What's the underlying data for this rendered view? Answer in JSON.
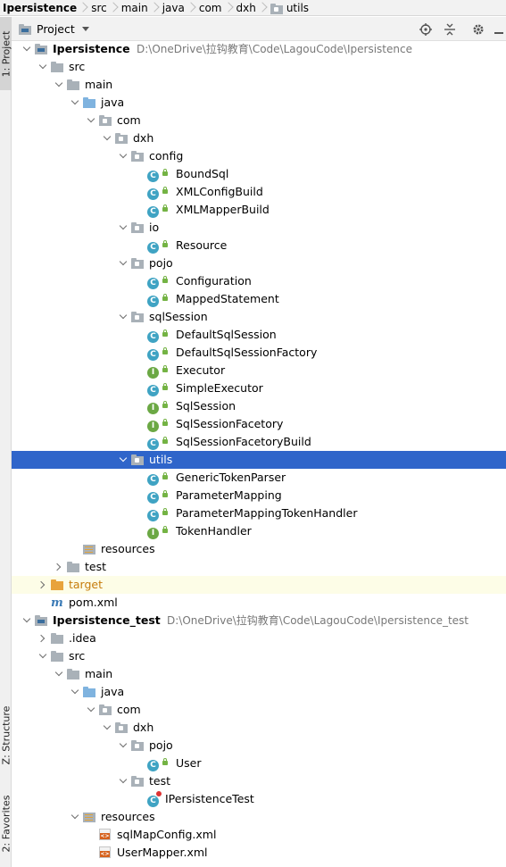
{
  "breadcrumb": [
    {
      "label": "Ipersistence",
      "icon": "module-icon"
    },
    {
      "label": "src",
      "icon": ""
    },
    {
      "label": "main",
      "icon": ""
    },
    {
      "label": "java",
      "icon": ""
    },
    {
      "label": "com",
      "icon": ""
    },
    {
      "label": "dxh",
      "icon": ""
    },
    {
      "label": "utils",
      "icon": "package-folder-icon"
    }
  ],
  "side_tabs": {
    "project": "1: Project",
    "structure": "Z: Structure",
    "favorites": "2: Favorites"
  },
  "panel": {
    "view_label": "Project",
    "buttons": [
      "locate-icon",
      "collapse-all-icon",
      "settings-icon",
      "hide-icon"
    ]
  },
  "colors": {
    "selection": "#2f65ca",
    "class_icon": "#3fa3c3",
    "interface_icon": "#6ba844",
    "excluded_folder": "#e8a33c"
  },
  "tree": [
    {
      "label": "Ipersistence",
      "path": "D:\\OneDrive\\拉钩教育\\Code\\LagouCode\\Ipersistence",
      "depth": 0,
      "expand": "open",
      "icon": "module",
      "bold": true
    },
    {
      "label": "src",
      "depth": 1,
      "expand": "open",
      "icon": "folder-grey"
    },
    {
      "label": "main",
      "depth": 2,
      "expand": "open",
      "icon": "folder-grey"
    },
    {
      "label": "java",
      "depth": 3,
      "expand": "open",
      "icon": "folder-blue"
    },
    {
      "label": "com",
      "depth": 4,
      "expand": "open",
      "icon": "package"
    },
    {
      "label": "dxh",
      "depth": 5,
      "expand": "open",
      "icon": "package"
    },
    {
      "label": "config",
      "depth": 6,
      "expand": "open",
      "icon": "package"
    },
    {
      "label": "BoundSql",
      "depth": 7,
      "icon": "class"
    },
    {
      "label": "XMLConfigBuild",
      "depth": 7,
      "icon": "class"
    },
    {
      "label": "XMLMapperBuild",
      "depth": 7,
      "icon": "class"
    },
    {
      "label": "io",
      "depth": 6,
      "expand": "open",
      "icon": "package"
    },
    {
      "label": "Resource",
      "depth": 7,
      "icon": "class"
    },
    {
      "label": "pojo",
      "depth": 6,
      "expand": "open",
      "icon": "package"
    },
    {
      "label": "Configuration",
      "depth": 7,
      "icon": "class"
    },
    {
      "label": "MappedStatement",
      "depth": 7,
      "icon": "class"
    },
    {
      "label": "sqlSession",
      "depth": 6,
      "expand": "open",
      "icon": "package"
    },
    {
      "label": "DefaultSqlSession",
      "depth": 7,
      "icon": "class"
    },
    {
      "label": "DefaultSqlSessionFactory",
      "depth": 7,
      "icon": "class"
    },
    {
      "label": "Executor",
      "depth": 7,
      "icon": "interface"
    },
    {
      "label": "SimpleExecutor",
      "depth": 7,
      "icon": "class"
    },
    {
      "label": "SqlSession",
      "depth": 7,
      "icon": "interface"
    },
    {
      "label": "SqlSessionFacetory",
      "depth": 7,
      "icon": "interface"
    },
    {
      "label": "SqlSessionFacetoryBuild",
      "depth": 7,
      "icon": "class"
    },
    {
      "label": "utils",
      "depth": 6,
      "expand": "open",
      "icon": "package",
      "selected": true
    },
    {
      "label": "GenericTokenParser",
      "depth": 7,
      "icon": "class"
    },
    {
      "label": "ParameterMapping",
      "depth": 7,
      "icon": "class"
    },
    {
      "label": "ParameterMappingTokenHandler",
      "depth": 7,
      "icon": "class"
    },
    {
      "label": "TokenHandler",
      "depth": 7,
      "icon": "interface"
    },
    {
      "label": "resources",
      "depth": 3,
      "icon": "resources"
    },
    {
      "label": "test",
      "depth": 2,
      "expand": "closed",
      "icon": "folder-grey"
    },
    {
      "label": "target",
      "depth": 1,
      "expand": "closed",
      "icon": "folder-orange",
      "orange": true,
      "highlight": true
    },
    {
      "label": "pom.xml",
      "depth": 1,
      "icon": "maven"
    },
    {
      "label": "Ipersistence_test",
      "path": "D:\\OneDrive\\拉钩教育\\Code\\LagouCode\\Ipersistence_test",
      "depth": 0,
      "expand": "open",
      "icon": "module",
      "bold": true
    },
    {
      "label": ".idea",
      "depth": 1,
      "expand": "closed",
      "icon": "folder-grey"
    },
    {
      "label": "src",
      "depth": 1,
      "expand": "open",
      "icon": "folder-grey"
    },
    {
      "label": "main",
      "depth": 2,
      "expand": "open",
      "icon": "folder-grey"
    },
    {
      "label": "java",
      "depth": 3,
      "expand": "open",
      "icon": "folder-blue"
    },
    {
      "label": "com",
      "depth": 4,
      "expand": "open",
      "icon": "package"
    },
    {
      "label": "dxh",
      "depth": 5,
      "expand": "open",
      "icon": "package"
    },
    {
      "label": "pojo",
      "depth": 6,
      "expand": "open",
      "icon": "package"
    },
    {
      "label": "User",
      "depth": 7,
      "icon": "class"
    },
    {
      "label": "test",
      "depth": 6,
      "expand": "open",
      "icon": "package"
    },
    {
      "label": "IPersistenceTest",
      "depth": 7,
      "icon": "test-class"
    },
    {
      "label": "resources",
      "depth": 3,
      "expand": "open",
      "icon": "resources"
    },
    {
      "label": "sqlMapConfig.xml",
      "depth": 4,
      "icon": "xml"
    },
    {
      "label": "UserMapper.xml",
      "depth": 4,
      "icon": "xml"
    }
  ]
}
